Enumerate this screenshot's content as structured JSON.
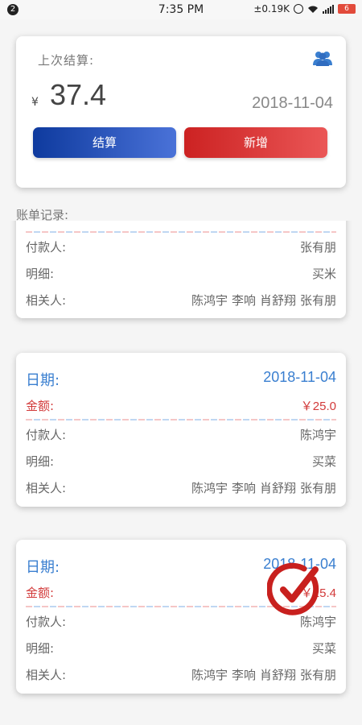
{
  "status_bar": {
    "notification_count": "2",
    "time": "7:35 PM",
    "network_speed": "±0.19K",
    "battery": "6"
  },
  "summary": {
    "title": "上次结算:",
    "currency": "¥",
    "amount": "37.4",
    "date": "2018-11-04",
    "settle_label": "结算",
    "add_label": "新增"
  },
  "records_label": "账单记录:",
  "labels": {
    "date": "日期:",
    "amount": "金额:",
    "payer": "付款人:",
    "detail": "明细:",
    "related": "相关人:"
  },
  "records": [
    {
      "date": "",
      "amount": "",
      "payer": "张有朋",
      "detail": "买米",
      "related": [
        "陈鸿宇",
        "李响",
        "肖舒翔",
        "张有朋"
      ]
    },
    {
      "date": "2018-11-04",
      "amount": "￥25.0",
      "payer": "陈鸿宇",
      "detail": "买菜",
      "related": [
        "陈鸿宇",
        "李响",
        "肖舒翔",
        "张有朋"
      ]
    },
    {
      "date": "2018-11-04",
      "amount": "￥25.4",
      "payer": "陈鸿宇",
      "detail": "买菜",
      "related": [
        "陈鸿宇",
        "李响",
        "肖舒翔",
        "张有朋"
      ],
      "settled": true
    }
  ],
  "colors": {
    "settle_button": "#1a47b0",
    "add_button": "#d83030",
    "date_blue": "#3a7fd0",
    "amount_red": "#d23a3a",
    "stamp_red": "#c8201e"
  },
  "icons": {
    "group": "group-icon",
    "settled_stamp": "check-stamp-icon"
  }
}
